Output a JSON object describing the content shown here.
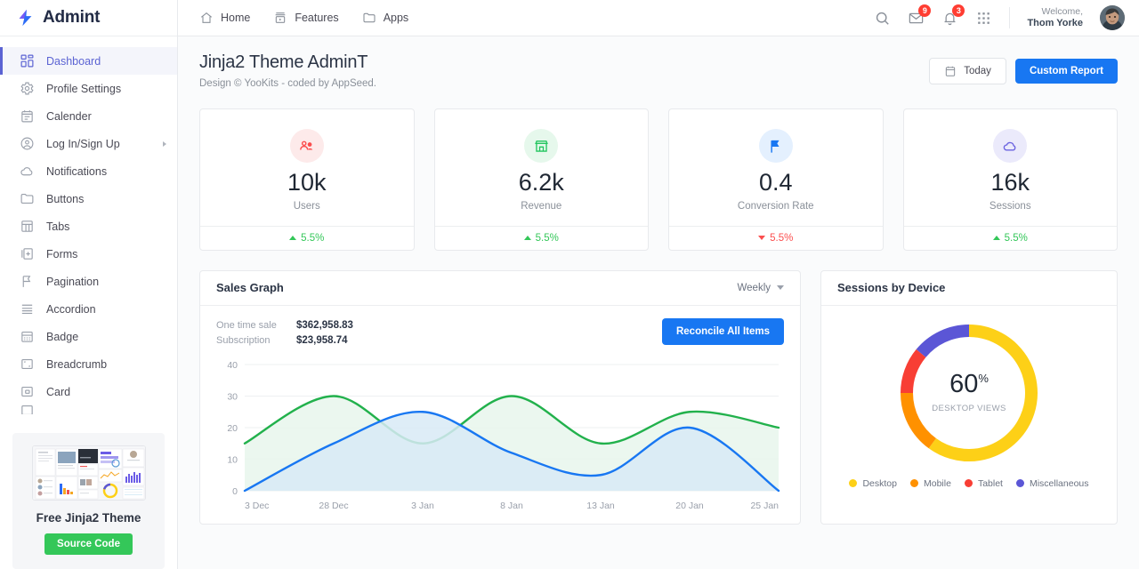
{
  "brand": {
    "name": "Admint",
    "logo_icon": "bolt-logo-icon"
  },
  "sidebar": {
    "items": [
      {
        "label": "Dashboard",
        "icon": "grid-icon",
        "active": true,
        "submenu": false
      },
      {
        "label": "Profile Settings",
        "icon": "gear-icon",
        "active": false,
        "submenu": false
      },
      {
        "label": "Calender",
        "icon": "calendar-icon",
        "active": false,
        "submenu": false
      },
      {
        "label": "Log In/Sign Up",
        "icon": "user-circle-icon",
        "active": false,
        "submenu": true
      },
      {
        "label": "Notifications",
        "icon": "cloud-icon",
        "active": false,
        "submenu": false
      },
      {
        "label": "Buttons",
        "icon": "folder-icon",
        "active": false,
        "submenu": false
      },
      {
        "label": "Tabs",
        "icon": "table-icon",
        "active": false,
        "submenu": false
      },
      {
        "label": "Forms",
        "icon": "form-icon",
        "active": false,
        "submenu": false
      },
      {
        "label": "Pagination",
        "icon": "flag-icon",
        "active": false,
        "submenu": false
      },
      {
        "label": "Accordion",
        "icon": "rows-icon",
        "active": false,
        "submenu": false
      },
      {
        "label": "Badge",
        "icon": "badge-icon",
        "active": false,
        "submenu": false
      },
      {
        "label": "Breadcrumb",
        "icon": "breadcrumb-icon",
        "active": false,
        "submenu": false
      },
      {
        "label": "Card",
        "icon": "card-icon",
        "active": false,
        "submenu": false
      }
    ],
    "promo": {
      "title": "Free Jinja2 Theme",
      "button": "Source Code",
      "button_color": "#34c759"
    }
  },
  "topbar": {
    "nav": [
      {
        "label": "Home",
        "icon": "home-icon"
      },
      {
        "label": "Features",
        "icon": "video-box-icon"
      },
      {
        "label": "Apps",
        "icon": "folder-icon"
      }
    ],
    "search_icon": "search-icon",
    "mail": {
      "icon": "mail-icon",
      "badge": "9"
    },
    "bell": {
      "icon": "bell-icon",
      "badge": "3"
    },
    "apps_icon": "apps-grid-icon",
    "welcome_prefix": "Welcome,",
    "user_name": "Thom Yorke",
    "badge_color": "#ff3d32"
  },
  "page": {
    "title": "Jinja2 Theme AdminT",
    "subtitle": "Design © YooKits - coded by AppSeed.",
    "today_button": "Today",
    "today_icon": "calendar-icon",
    "custom_report_button": "Custom Report",
    "primary_color": "#1877f2"
  },
  "stats": [
    {
      "value": "10k",
      "label": "Users",
      "icon": "people-icon",
      "icon_color": "#fb4e4e",
      "icon_bg": "#fdeaea",
      "delta": "5.5%",
      "delta_dir": "up",
      "delta_color": "#34c759"
    },
    {
      "value": "6.2k",
      "label": "Revenue",
      "icon": "store-icon",
      "icon_color": "#22c55e",
      "icon_bg": "#e6f8ec",
      "delta": "5.5%",
      "delta_dir": "up",
      "delta_color": "#34c759"
    },
    {
      "value": "0.4",
      "label": "Conversion Rate",
      "icon": "flag-icon",
      "icon_color": "#1877f2",
      "icon_bg": "#e4f0fe",
      "delta": "5.5%",
      "delta_dir": "down",
      "delta_color": "#fb4e4e"
    },
    {
      "value": "16k",
      "label": "Sessions",
      "icon": "cloud-icon",
      "icon_color": "#6b63e0",
      "icon_bg": "#ebeafb",
      "delta": "5.5%",
      "delta_dir": "up",
      "delta_color": "#34c759"
    }
  ],
  "sales_card": {
    "title": "Sales Graph",
    "dropdown_value": "Weekly",
    "one_time_sale_label": "One time sale",
    "one_time_sale_value": "$362,958.83",
    "subscription_label": "Subscription",
    "subscription_value": "$23,958.74",
    "reconcile_button": "Reconcile All Items"
  },
  "devices_card": {
    "title": "Sessions by Device",
    "center_value": "60",
    "center_unit": "%",
    "center_label": "DESKTOP VIEWS"
  },
  "chart_data": [
    {
      "type": "area",
      "title": "Sales Graph",
      "xlabel": "",
      "ylabel": "",
      "x": [
        "3 Dec",
        "28 Dec",
        "3 Jan",
        "8 Jan",
        "13 Jan",
        "20 Jan",
        "25 Jan"
      ],
      "ylim": [
        0,
        40
      ],
      "yticks": [
        0,
        10,
        20,
        30,
        40
      ],
      "grid": true,
      "legend": "none",
      "series": [
        {
          "name": "One time sale",
          "color": "#22b14c",
          "fill": "#e8f6ec",
          "values": [
            15,
            30,
            15,
            30,
            15,
            25,
            20
          ]
        },
        {
          "name": "Subscription",
          "color": "#1877f2",
          "fill": "#d8eaf6",
          "values": [
            0,
            15,
            25,
            12,
            5,
            20,
            0
          ]
        }
      ]
    },
    {
      "type": "pie",
      "title": "Sessions by Device",
      "donut": true,
      "labels": [
        "Desktop",
        "Mobile",
        "Tablet",
        "Miscellaneous"
      ],
      "values": [
        60,
        15,
        11,
        14
      ],
      "colors": [
        "#fdd017",
        "#ff9100",
        "#f83e34",
        "#5b56d6"
      ],
      "legend": "bottom",
      "center_text": "60%",
      "center_subtext": "DESKTOP VIEWS"
    }
  ]
}
